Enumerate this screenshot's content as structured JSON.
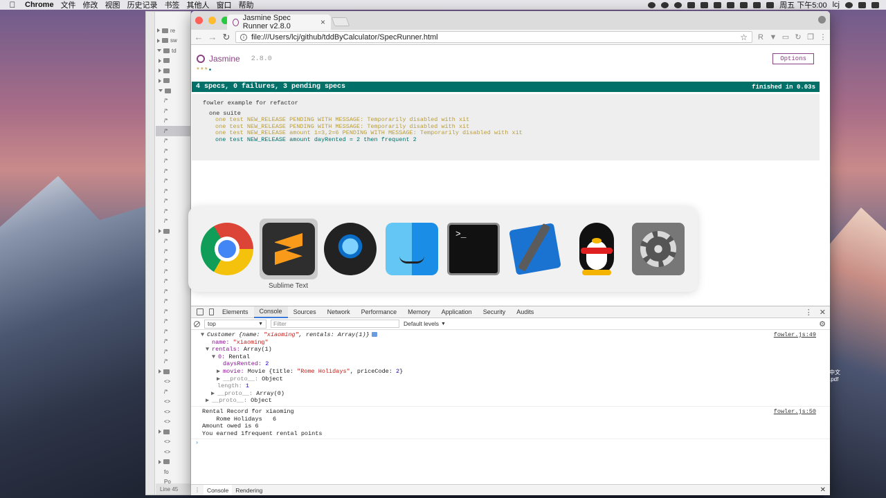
{
  "menubar": {
    "app_name": "Chrome",
    "items": [
      "文件",
      "修改",
      "视图",
      "历史记录",
      "书签",
      "其他人",
      "窗口",
      "帮助"
    ],
    "clock": "周五 下午5:00",
    "user": "lcj"
  },
  "editor": {
    "tree_rows": [
      "re",
      "sw",
      "td",
      "",
      "",
      "",
      "",
      "/*",
      "/*",
      "/*",
      "/*",
      "/*",
      "/*",
      "/*",
      "/*",
      "/*",
      "/*",
      "/*",
      "/*",
      "/*",
      "",
      "/*",
      "/*",
      "/*",
      "/*",
      "/*",
      "/*",
      "/*",
      "/*",
      "/*",
      "/*",
      "/*",
      "/*",
      "/*",
      "",
      "<>",
      "/*",
      "<>",
      "<>",
      "<>",
      "",
      "<>",
      "<>",
      "",
      "fo",
      "Po"
    ],
    "status": "Line 45"
  },
  "browser": {
    "tab_title": "Jasmine Spec Runner v2.8.0",
    "url": "file:///Users/lcj/github/tddByCalculator/SpecRunner.html"
  },
  "jasmine": {
    "name": "Jasmine",
    "version": "2.8.0",
    "dots_pending": "***",
    "dot_passed": "•",
    "options_label": "Options",
    "summary": "4 specs, 0 failures, 3 pending specs",
    "duration": "finished in 0.03s",
    "top_suite": "fowler example for refactor",
    "suite": "one suite",
    "specs": [
      {
        "text": "one test NEW_RELEASE PENDING WITH MESSAGE: Temporarily disabled with xit",
        "status": "pending"
      },
      {
        "text": "one test NEW_RELEASE PENDING WITH MESSAGE: Temporarily disabled with xit",
        "status": "pending"
      },
      {
        "text": "one test NEW_RELEASE amount 1=3,2=6 PENDING WITH MESSAGE: Temporarily disabled with xit",
        "status": "pending"
      },
      {
        "text": "one test NEW_RELEASE amount dayRented = 2 then frequent 2",
        "status": "passed"
      }
    ]
  },
  "switcher": {
    "apps": [
      "chrome-icon",
      "sublime-text-icon",
      "quicktime-icon",
      "finder-icon",
      "terminal-icon",
      "xcode-icon",
      "qq-icon",
      "system-preferences-icon"
    ],
    "selected_label": "Sublime Text",
    "terminal_glyph": ">_"
  },
  "devtools": {
    "tabs": [
      "Elements",
      "Console",
      "Sources",
      "Network",
      "Performance",
      "Memory",
      "Application",
      "Security",
      "Audits"
    ],
    "active_tab": "Console",
    "context": "top",
    "filter_placeholder": "Filter",
    "levels": "Default levels",
    "log1": {
      "source": "fowler.js:49",
      "head_class": "Customer",
      "head_body": "{name: ",
      "head_name": "\"xiaoming\"",
      "head_rest": ", rentals: Array(1)}",
      "name_key": "name:",
      "name_val": "\"xiaoming\"",
      "rentals_key": "rentals:",
      "rentals_val": "Array(1)",
      "item_key": "0:",
      "item_val": "Rental",
      "days_key": "daysRented:",
      "days_val": "2",
      "movie_key": "movie:",
      "movie_pre": "Movie {title: ",
      "movie_title": "\"Rome Holidays\"",
      "movie_mid": ", priceCode: ",
      "movie_code": "2",
      "movie_end": "}",
      "proto_key": "__proto__:",
      "proto_val": "Object",
      "length_key": "length:",
      "length_val": "1",
      "arr_proto_val": "Array(0)"
    },
    "log2": {
      "source": "fowler.js:50",
      "lines": [
        "Rental Record for xiaoming",
        "    Rome Holidays   6",
        "Amount owed is 6",
        "You earned 1frequent rental points"
      ]
    },
    "drawer_tabs": [
      "Console",
      "Rendering"
    ]
  },
  "desktop": {
    "files": [
      "中文",
      ".pdf"
    ]
  },
  "colors": {
    "jasmine_purple": "#8a4182",
    "passed_green": "#007069",
    "pending_gold": "#ba9d37",
    "devtools_blue": "#3879d9"
  }
}
